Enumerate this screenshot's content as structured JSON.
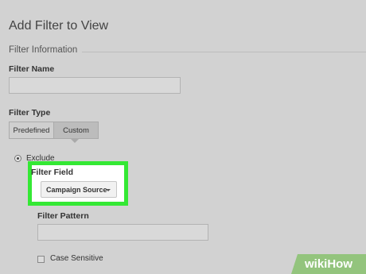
{
  "page": {
    "title": "Add Filter to View"
  },
  "section": {
    "title": "Filter Information"
  },
  "filter_name": {
    "label": "Filter Name",
    "value": ""
  },
  "filter_type": {
    "label": "Filter Type",
    "options": [
      "Predefined",
      "Custom"
    ],
    "selected": "Custom"
  },
  "exclude": {
    "label": "Exclude",
    "selected": true
  },
  "filter_field": {
    "label": "Filter Field",
    "value": "Campaign Source",
    "icon": "chevron-down-icon"
  },
  "filter_pattern": {
    "label": "Filter Pattern",
    "value": ""
  },
  "case_sensitive": {
    "label": "Case Sensitive",
    "checked": false
  },
  "watermark": {
    "text": "wikiHow",
    "color": "#93c47d"
  },
  "colors": {
    "highlight": "#34e834",
    "background": "#d2d2d2"
  }
}
